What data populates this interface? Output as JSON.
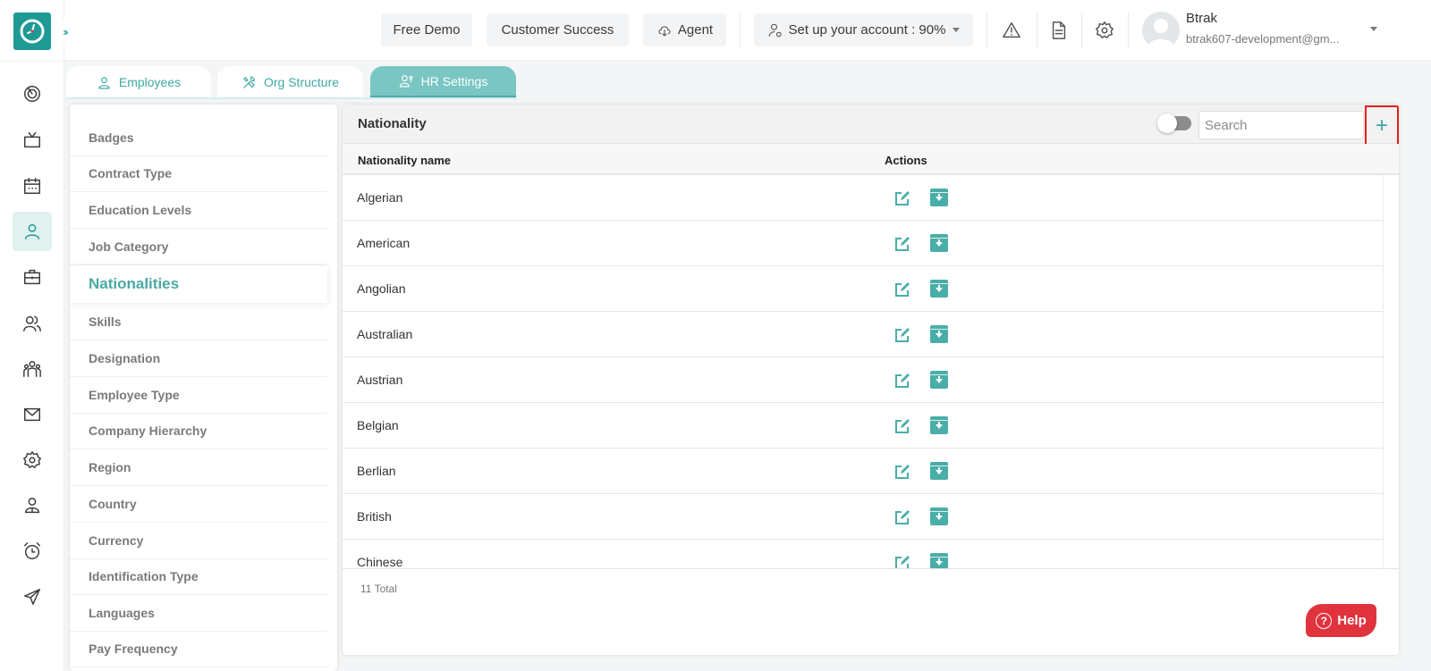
{
  "header": {
    "buttons": {
      "free_demo": "Free Demo",
      "customer_success": "Customer Success",
      "agent": "Agent",
      "setup": "Set up your account : 90%"
    },
    "user": {
      "name": "Btrak",
      "email": "btrak607-development@gm..."
    }
  },
  "rail": {
    "expand_glyph": "›››",
    "items": [
      {
        "icon": "dashboard-icon"
      },
      {
        "icon": "tv-icon"
      },
      {
        "icon": "calendar-icon"
      },
      {
        "icon": "user-icon",
        "active": true
      },
      {
        "icon": "briefcase-icon"
      },
      {
        "icon": "users-icon"
      },
      {
        "icon": "team-icon"
      },
      {
        "icon": "mail-icon"
      },
      {
        "icon": "settings-icon"
      },
      {
        "icon": "profile-icon"
      },
      {
        "icon": "alarm-icon"
      },
      {
        "icon": "send-icon"
      }
    ]
  },
  "tabs": [
    {
      "label": "Employees"
    },
    {
      "label": "Org Structure"
    },
    {
      "label": "HR Settings",
      "active": true
    }
  ],
  "settings_menu": {
    "items": [
      "Badges",
      "Contract Type",
      "Education Levels",
      "Job Category",
      "Nationalities",
      "Skills",
      "Designation",
      "Employee Type",
      "Company Hierarchy",
      "Region",
      "Country",
      "Currency",
      "Identification Type",
      "Languages",
      "Pay Frequency"
    ],
    "active": "Nationalities"
  },
  "main": {
    "title": "Nationality",
    "search_placeholder": "Search",
    "add_label": "+",
    "columns": {
      "name": "Nationality name",
      "actions": "Actions"
    },
    "rows": [
      "Algerian",
      "American",
      "Angolian",
      "Australian",
      "Austrian",
      "Belgian",
      "Berlian",
      "British",
      "Chinese"
    ],
    "total": "11 Total"
  },
  "help": {
    "label": "Help",
    "glyph": "?"
  },
  "colors": {
    "accent": "#1e9a96",
    "tab_active": "#79c6c3",
    "help": "#e0333d",
    "highlight_border": "#e0201f"
  }
}
